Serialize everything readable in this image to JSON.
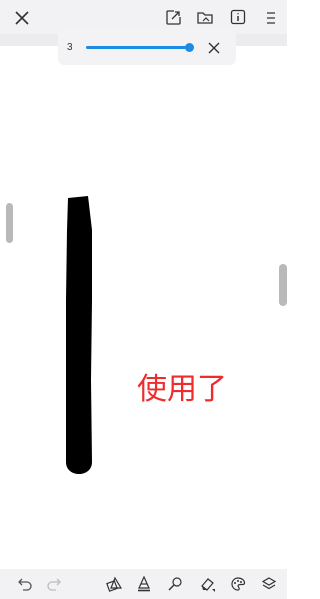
{
  "toolbar_top": {
    "close_icon": "close-icon",
    "icons": [
      "export-icon",
      "open-folder-icon",
      "info-icon",
      "menu-icon"
    ]
  },
  "brush_size": {
    "value": "3",
    "level": 1.0,
    "accent": "#1a8ce6"
  },
  "canvas": {
    "stroke_color": "#000000",
    "text": "使用了",
    "text_color": "#f02b2b"
  },
  "toolbar_bottom": {
    "icons": [
      "undo-icon",
      "redo-icon",
      "shapes-icon",
      "fill-icon",
      "brush-icon",
      "eraser-icon",
      "palette-icon",
      "layers-icon"
    ]
  }
}
